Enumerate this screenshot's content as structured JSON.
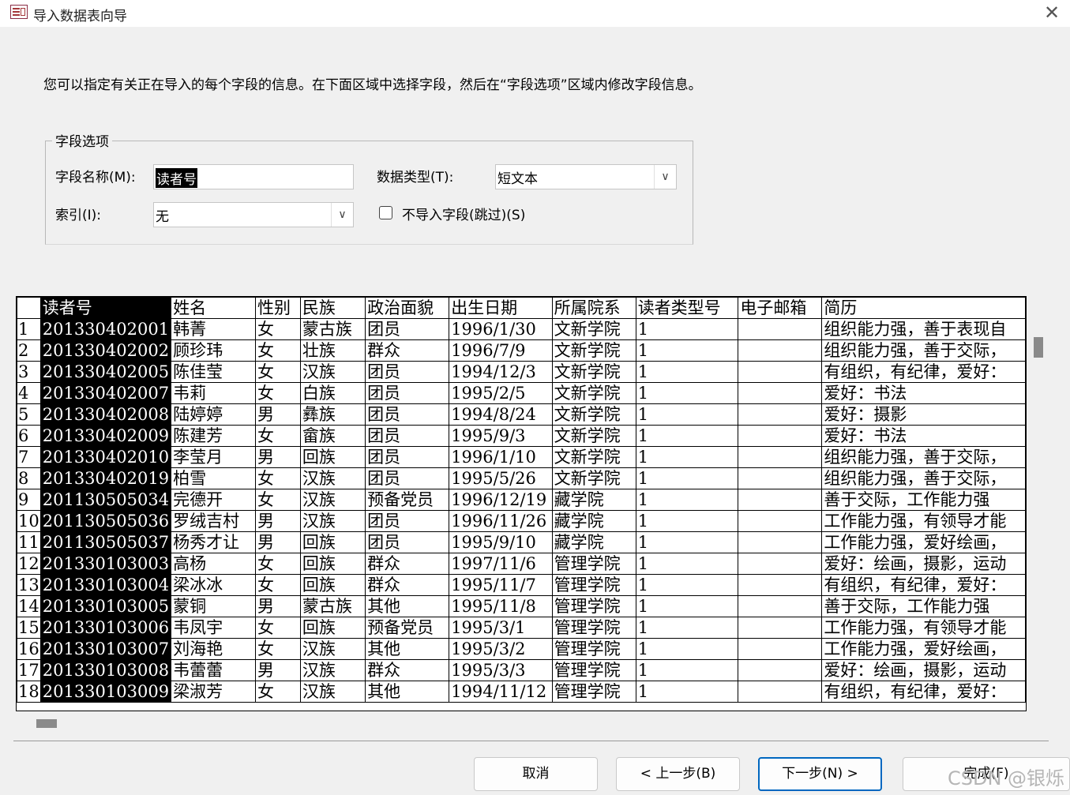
{
  "window": {
    "title": "导入数据表向导",
    "close_glyph": "✕"
  },
  "instruction": "您可以指定有关正在导入的每个字段的信息。在下面区域中选择字段，然后在“字段选项”区域内修改字段信息。",
  "field_options": {
    "legend": "字段选项",
    "field_name_label": "字段名称(M):",
    "field_name_value": "读者号",
    "data_type_label": "数据类型(T):",
    "data_type_value": "短文本",
    "index_label": "索引(I):",
    "index_value": "无",
    "skip_label": "不导入字段(跳过)(S)",
    "skip_checked": false
  },
  "grid": {
    "headers": [
      "读者号",
      "姓名",
      "性别",
      "民族",
      "政治面貌",
      "出生日期",
      "所属院系",
      "读者类型号",
      "电子邮箱",
      "简历"
    ],
    "rows": [
      [
        "1",
        "201330402001",
        "韩菁",
        "女",
        "蒙古族",
        "团员",
        "1996/1/30",
        "文新学院",
        "1",
        "",
        "组织能力强，善于表现自"
      ],
      [
        "2",
        "201330402002",
        "顾珍玮",
        "女",
        "壮族",
        "群众",
        "1996/7/9",
        "文新学院",
        "1",
        "",
        "组织能力强，善于交际，"
      ],
      [
        "3",
        "201330402005",
        "陈佳莹",
        "女",
        "汉族",
        "团员",
        "1994/12/3",
        "文新学院",
        "1",
        "",
        "有组织，有纪律，爱好："
      ],
      [
        "4",
        "201330402007",
        "韦莉",
        "女",
        "白族",
        "团员",
        "1995/2/5",
        "文新学院",
        "1",
        "",
        "爱好：书法"
      ],
      [
        "5",
        "201330402008",
        "陆婷婷",
        "男",
        "彝族",
        "团员",
        "1994/8/24",
        "文新学院",
        "1",
        "",
        "爱好：摄影"
      ],
      [
        "6",
        "201330402009",
        "陈建芳",
        "女",
        "畲族",
        "团员",
        "1995/9/3",
        "文新学院",
        "1",
        "",
        "爱好：书法"
      ],
      [
        "7",
        "201330402010",
        "李莹月",
        "男",
        "回族",
        "团员",
        "1996/1/10",
        "文新学院",
        "1",
        "",
        "组织能力强，善于交际，"
      ],
      [
        "8",
        "201330402019",
        "柏雪",
        "女",
        "汉族",
        "团员",
        "1995/5/26",
        "文新学院",
        "1",
        "",
        "组织能力强，善于交际，"
      ],
      [
        "9",
        "201130505034",
        "完德开",
        "女",
        "汉族",
        "预备党员",
        "1996/12/19",
        "藏学院",
        "1",
        "",
        "善于交际，工作能力强"
      ],
      [
        "10",
        "201130505036",
        "罗绒吉村",
        "男",
        "汉族",
        "团员",
        "1996/11/26",
        "藏学院",
        "1",
        "",
        "工作能力强，有领导才能"
      ],
      [
        "11",
        "201130505037",
        "杨秀才让",
        "男",
        "回族",
        "团员",
        "1995/9/10",
        "藏学院",
        "1",
        "",
        "工作能力强，爱好绘画，"
      ],
      [
        "12",
        "201330103003",
        "高杨",
        "女",
        "回族",
        "群众",
        "1997/11/6",
        "管理学院",
        "1",
        "",
        "爱好：绘画，摄影，运动"
      ],
      [
        "13",
        "201330103004",
        "梁冰冰",
        "女",
        "回族",
        "群众",
        "1995/11/7",
        "管理学院",
        "1",
        "",
        "有组织，有纪律，爱好："
      ],
      [
        "14",
        "201330103005",
        "蒙铜",
        "男",
        "蒙古族",
        "其他",
        "1995/11/8",
        "管理学院",
        "1",
        "",
        "善于交际，工作能力强"
      ],
      [
        "15",
        "201330103006",
        "韦凤宇",
        "女",
        "回族",
        "预备党员",
        "1995/3/1",
        "管理学院",
        "1",
        "",
        "工作能力强，有领导才能"
      ],
      [
        "16",
        "201330103007",
        "刘海艳",
        "女",
        "汉族",
        "其他",
        "1995/3/2",
        "管理学院",
        "1",
        "",
        "工作能力强，爱好绘画，"
      ],
      [
        "17",
        "201330103008",
        "韦蕾蕾",
        "男",
        "汉族",
        "群众",
        "1995/3/3",
        "管理学院",
        "1",
        "",
        "爱好：绘画，摄影，运动"
      ],
      [
        "18",
        "201330103009",
        "梁淑芳",
        "女",
        "汉族",
        "其他",
        "1994/11/12",
        "管理学院",
        "1",
        "",
        "有组织，有纪律，爱好："
      ]
    ]
  },
  "buttons": {
    "cancel": "取消",
    "back": "< 上一步(B)",
    "next": "下一步(N) >",
    "finish": "完成(F)"
  },
  "watermark": "CSDN @银烁",
  "colors": {
    "selected_bg": "#000000",
    "primary_border": "#0067c0"
  }
}
